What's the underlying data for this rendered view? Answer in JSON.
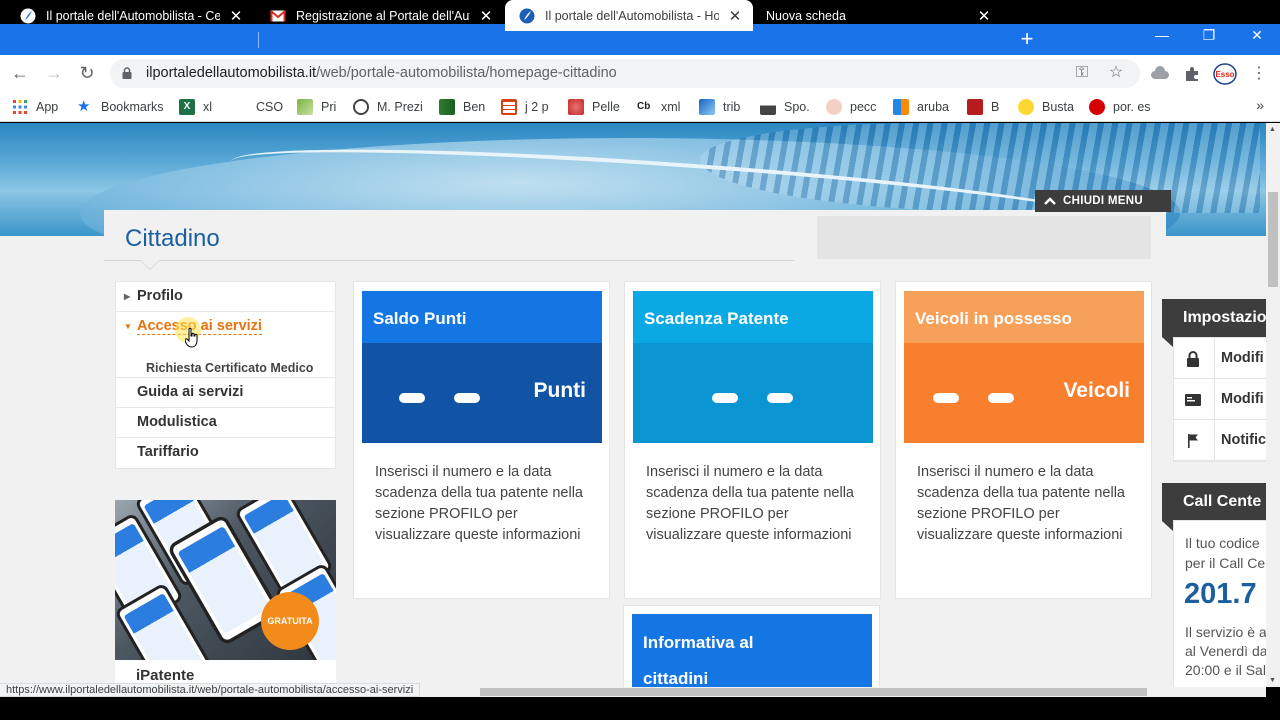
{
  "browser": {
    "tabs": [
      {
        "title": "Il portale dell'Automobilista - Ce",
        "active": false
      },
      {
        "title": "Registrazione al Portale dell'Auto",
        "active": false
      },
      {
        "title": "Il portale dell'Automobilista - Ho",
        "active": true
      },
      {
        "title": "Nuova scheda",
        "active": false
      }
    ],
    "url_domain": "ilportaledellautomobilista.it",
    "url_path": "/web/portale-automobilista/homepage-cittadino",
    "bookmarks": [
      "App",
      "Bookmarks",
      "xl",
      "CSO",
      "Pri",
      "M. Prezi",
      "Ben",
      "j 2 p",
      "Pelle",
      "xml",
      "trib",
      "Spo.",
      "pecc",
      "aruba",
      "B",
      "Busta",
      "por. es"
    ],
    "bookmark_more": "»",
    "status_url": "https://www.ilportaledellautomobilista.it/web/portale-automobilista/accesso-ai-servizi"
  },
  "page": {
    "chiudi_menu": "CHIUDI MENU",
    "title": "Cittadino"
  },
  "left_menu": {
    "items": [
      "Profilo",
      "Accesso ai servizi",
      "Guida ai servizi",
      "Modulistica",
      "Tariffario"
    ],
    "subitem": "Richiesta Certificato Medico",
    "promo_badge": "GRATUITA",
    "promo_caption": "iPatente"
  },
  "cards": [
    {
      "title": "Saldo Punti",
      "unit": "Punti",
      "color": "#1476e2",
      "body_color": "#1154a6",
      "text": "Inserisci il numero e la data scadenza della tua patente nella sezione PROFILO per visualizzare queste informazioni"
    },
    {
      "title": "Scadenza Patente",
      "unit": "",
      "color": "#0ba9e3",
      "body_color": "#0b94d2",
      "text": "Inserisci il numero e la data scadenza della tua patente nella sezione PROFILO per visualizzare queste informazioni"
    },
    {
      "title": "Veicoli in possesso",
      "unit": "Veicoli",
      "color": "#f7a05a",
      "body_color": "#f77f2e",
      "text": "Inserisci il numero e la data scadenza della tua patente nella sezione PROFILO per visualizzare queste informazioni"
    }
  ],
  "card4": {
    "title_line1": "Informativa al",
    "title_line2": "cittadini"
  },
  "right_sidebar": {
    "settings_title": "Impostazio",
    "settings_rows": [
      "Modifi",
      "Modifi",
      "Notific"
    ],
    "callcenter_title": "Call Cente",
    "cc_line1": "Il tuo codice",
    "cc_line2": "per il Call Ce",
    "cc_number": "201.7",
    "cc_line3": "Il servizio è a",
    "cc_line4": "al Venerdì da",
    "cc_line5": "20:00 e il Sal"
  }
}
